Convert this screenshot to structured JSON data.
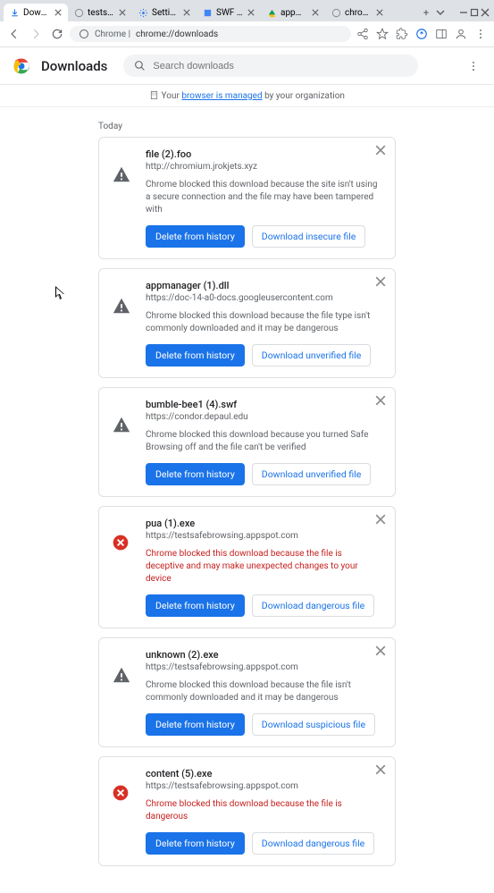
{
  "tabs": [
    {
      "title": "Downloads"
    },
    {
      "title": "testsafebr…"
    },
    {
      "title": "Settings - …"
    },
    {
      "title": "SWF File D…"
    },
    {
      "title": "appmanag…"
    },
    {
      "title": "chromium…"
    }
  ],
  "omnibox": {
    "prefix": "Chrome |",
    "value": "chrome://downloads"
  },
  "downloads_page": {
    "title": "Downloads",
    "search_placeholder": "Search downloads"
  },
  "managed": {
    "prefix": "Your ",
    "link": "browser is managed",
    "suffix": " by your organization"
  },
  "section_label": "Today",
  "buttons": {
    "delete": "Delete from history",
    "insecure": "Download insecure file",
    "unverified": "Download unverified file",
    "dangerous": "Download dangerous file",
    "suspicious": "Download suspicious file"
  },
  "items": [
    {
      "name": "file (2).foo",
      "url": "http://chromium.jrokjets.xyz",
      "msg": "Chrome blocked this download because the site isn't using a secure connection and the file may have been tampered with",
      "danger": false,
      "secondary": "insecure",
      "icon": "warn"
    },
    {
      "name": "appmanager (1).dll",
      "url": "https://doc-14-a0-docs.googleusercontent.com",
      "msg": "Chrome blocked this download because the file type isn't commonly downloaded and it may be dangerous",
      "danger": false,
      "secondary": "unverified",
      "icon": "warn"
    },
    {
      "name": "bumble-bee1 (4).swf",
      "url": "https://condor.depaul.edu",
      "msg": "Chrome blocked this download because you turned Safe Browsing off and the file can't be verified",
      "danger": false,
      "secondary": "unverified",
      "icon": "warn"
    },
    {
      "name": "pua (1).exe",
      "url": "https://testsafebrowsing.appspot.com",
      "msg": "Chrome blocked this download because the file is deceptive and may make unexpected changes to your device",
      "danger": true,
      "secondary": "dangerous",
      "icon": "block"
    },
    {
      "name": "unknown (2).exe",
      "url": "https://testsafebrowsing.appspot.com",
      "msg": "Chrome blocked this download because the file isn't commonly downloaded and it may be dangerous",
      "danger": false,
      "secondary": "suspicious",
      "icon": "warn"
    },
    {
      "name": "content (5).exe",
      "url": "https://testsafebrowsing.appspot.com",
      "msg": "Chrome blocked this download because the file is dangerous",
      "danger": true,
      "secondary": "dangerous",
      "icon": "block"
    }
  ]
}
